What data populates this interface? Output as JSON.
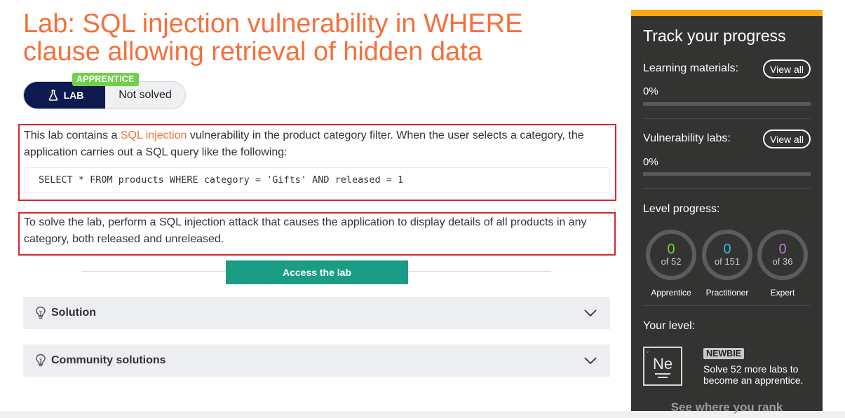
{
  "lab": {
    "title": "Lab: SQL injection vulnerability in WHERE clause allowing retrieval of hidden data",
    "level_badge": "APPRENTICE",
    "lab_label": "LAB",
    "status": "Not solved",
    "description_before_link": "This lab contains a ",
    "description_link": "SQL injection",
    "description_after_link": " vulnerability in the product category filter. When the user selects a category, the application carries out a SQL query like the following:",
    "sql_query": "SELECT * FROM products WHERE category = 'Gifts' AND released = 1",
    "goal": "To solve the lab, perform a SQL injection attack that causes the application to display details of all products in any category, both released and unreleased.",
    "access_button": "Access the lab",
    "accordions": [
      {
        "label": "Solution"
      },
      {
        "label": "Community solutions"
      }
    ]
  },
  "sidebar": {
    "title": "Track your progress",
    "learning": {
      "label": "Learning materials:",
      "view_all": "View all",
      "percent": "0%",
      "progress": 0
    },
    "vuln": {
      "label": "Vulnerability labs:",
      "view_all": "View all",
      "percent": "0%",
      "progress": 0
    },
    "level_progress_label": "Level progress:",
    "levels": [
      {
        "count": "0",
        "total": "of 52",
        "name": "Apprentice",
        "color": "#70d04a"
      },
      {
        "count": "0",
        "total": "of 151",
        "name": "Practitioner",
        "color": "#33b5f0"
      },
      {
        "count": "0",
        "total": "of 36",
        "name": "Expert",
        "color": "#b97ad9"
      }
    ],
    "your_level_label": "Your level:",
    "element_symbol": "Ne",
    "level_name": "NEWBIE",
    "level_desc": "Solve 52 more labs to become an apprentice.",
    "see_rank": "See where you rank"
  },
  "colors": {
    "title_orange": "#f5703c",
    "lab_navy": "#0c1a4f",
    "apprentice_green": "#70d04a",
    "access_teal": "#1a9d84",
    "highlight_red": "#d9262c",
    "sidebar_bg": "#333332",
    "sidebar_accent": "#ffa814"
  },
  "icons": [
    "flask-icon",
    "lightbulb-icon",
    "chevron-down-icon"
  ]
}
